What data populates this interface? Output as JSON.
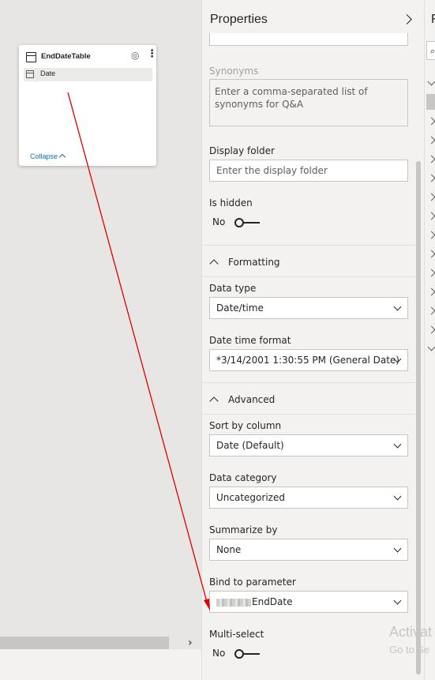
{
  "table_card": {
    "title": "EndDateTable",
    "field": "Date",
    "collapse_label": "Collapse"
  },
  "properties": {
    "title": "Properties",
    "synonyms_label": "Synonyms",
    "synonyms_placeholder": "Enter a comma-separated list of synonyms for Q&A",
    "display_folder_label": "Display folder",
    "display_folder_placeholder": "Enter the display folder",
    "is_hidden_label": "Is hidden",
    "is_hidden_value": "No",
    "formatting_header": "Formatting",
    "data_type_label": "Data type",
    "data_type_value": "Date/time",
    "date_time_format_label": "Date time format",
    "date_time_format_value": "*3/14/2001 1:30:55 PM (General Date)",
    "advanced_header": "Advanced",
    "sort_by_label": "Sort by column",
    "sort_by_value": "Date (Default)",
    "data_category_label": "Data category",
    "data_category_value": "Uncategorized",
    "summarize_by_label": "Summarize by",
    "summarize_by_value": "None",
    "bind_param_label": "Bind to parameter",
    "bind_param_value": "EndDate",
    "multi_select_label": "Multi-select",
    "multi_select_value": "No"
  },
  "fields_pane": {
    "title_fragment": "F"
  },
  "watermark": {
    "line1": "Activat",
    "line2": "Go to Se"
  },
  "icons": {
    "table": "table-icon",
    "eye": "eye-icon",
    "more": "more-options-icon",
    "calendar": "calendar-icon"
  },
  "colors": {
    "link": "#106ebe",
    "annotation_arrow": "#e00000"
  }
}
